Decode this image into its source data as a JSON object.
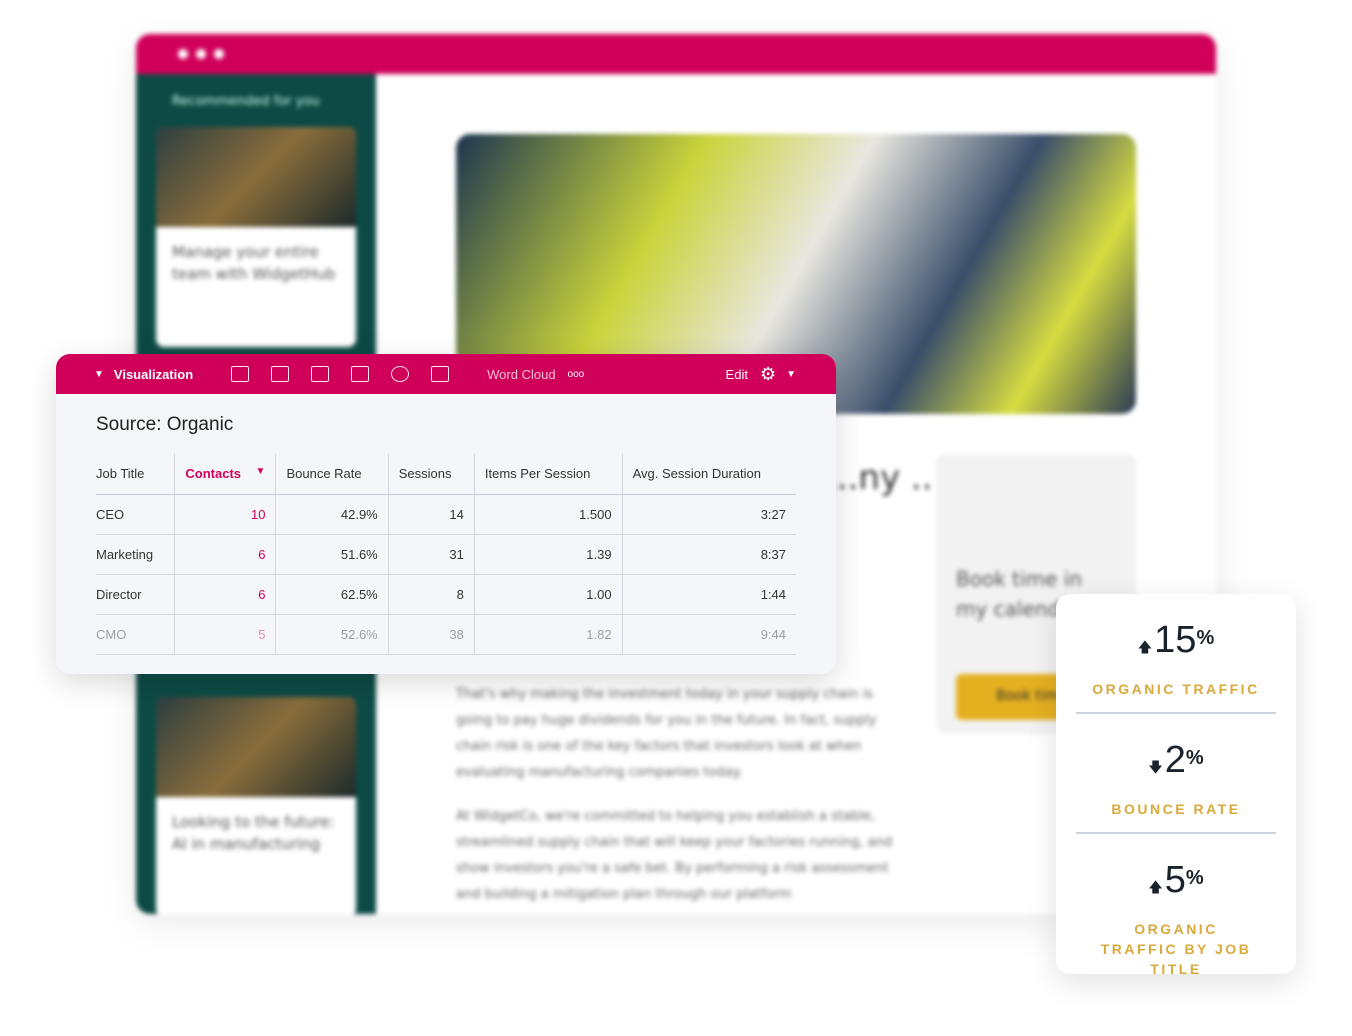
{
  "background": {
    "sidebar_title": "Recommended for you",
    "cards": [
      "Manage your entire team with WidgetHub",
      "Looking to the future: AI in manufacturing"
    ],
    "headline": "...ny ...ar",
    "paragraphs": [
      "That's why making the investment today in your supply chain is going to pay huge dividends for you in the future. In fact, supply chain risk is one of the key factors that investors look at when evaluating manufacturing companies today.",
      "At WidgetCo, we're committed to helping you establish a stable, streamlined supply chain that will keep your factories running, and show investors you're a safe bet. By performing a risk assessment and building a mitigation plan through our platform"
    ],
    "book_title": "Book time in my calendar",
    "book_button": "Book time"
  },
  "panel": {
    "toolbar": {
      "title": "Visualization",
      "icons": [
        "table-icon",
        "combo-chart-icon",
        "bar-chart-icon",
        "area-chart-icon",
        "pie-chart-icon",
        "line-chart-icon"
      ],
      "word_cloud": "Word Cloud",
      "more": "ooo",
      "edit": "Edit"
    },
    "source": "Source: Organic",
    "columns": [
      "Job Title",
      "Contacts",
      "Bounce Rate",
      "Sessions",
      "Items Per Session",
      "Avg. Session Duration"
    ],
    "rows": [
      [
        "CEO",
        "10",
        "42.9%",
        "14",
        "1.500",
        "3:27"
      ],
      [
        "Marketing",
        "6",
        "51.6%",
        "31",
        "1.39",
        "8:37"
      ],
      [
        "Director",
        "6",
        "62.5%",
        "8",
        "1.00",
        "1:44"
      ],
      [
        "CMO",
        "5",
        "52.6%",
        "38",
        "1.82",
        "9:44"
      ]
    ]
  },
  "stats": [
    {
      "direction": "up",
      "value": "15",
      "unit": "%",
      "label": "ORGANIC TRAFFIC"
    },
    {
      "direction": "down",
      "value": "2",
      "unit": "%",
      "label": "BOUNCE RATE"
    },
    {
      "direction": "up",
      "value": "5",
      "unit": "%",
      "label": "ORGANIC TRAFFIC BY JOB TITLE"
    }
  ],
  "colors": {
    "brand": "#d0005a",
    "sidebar": "#0d4a45",
    "accent": "#d9a93c"
  }
}
